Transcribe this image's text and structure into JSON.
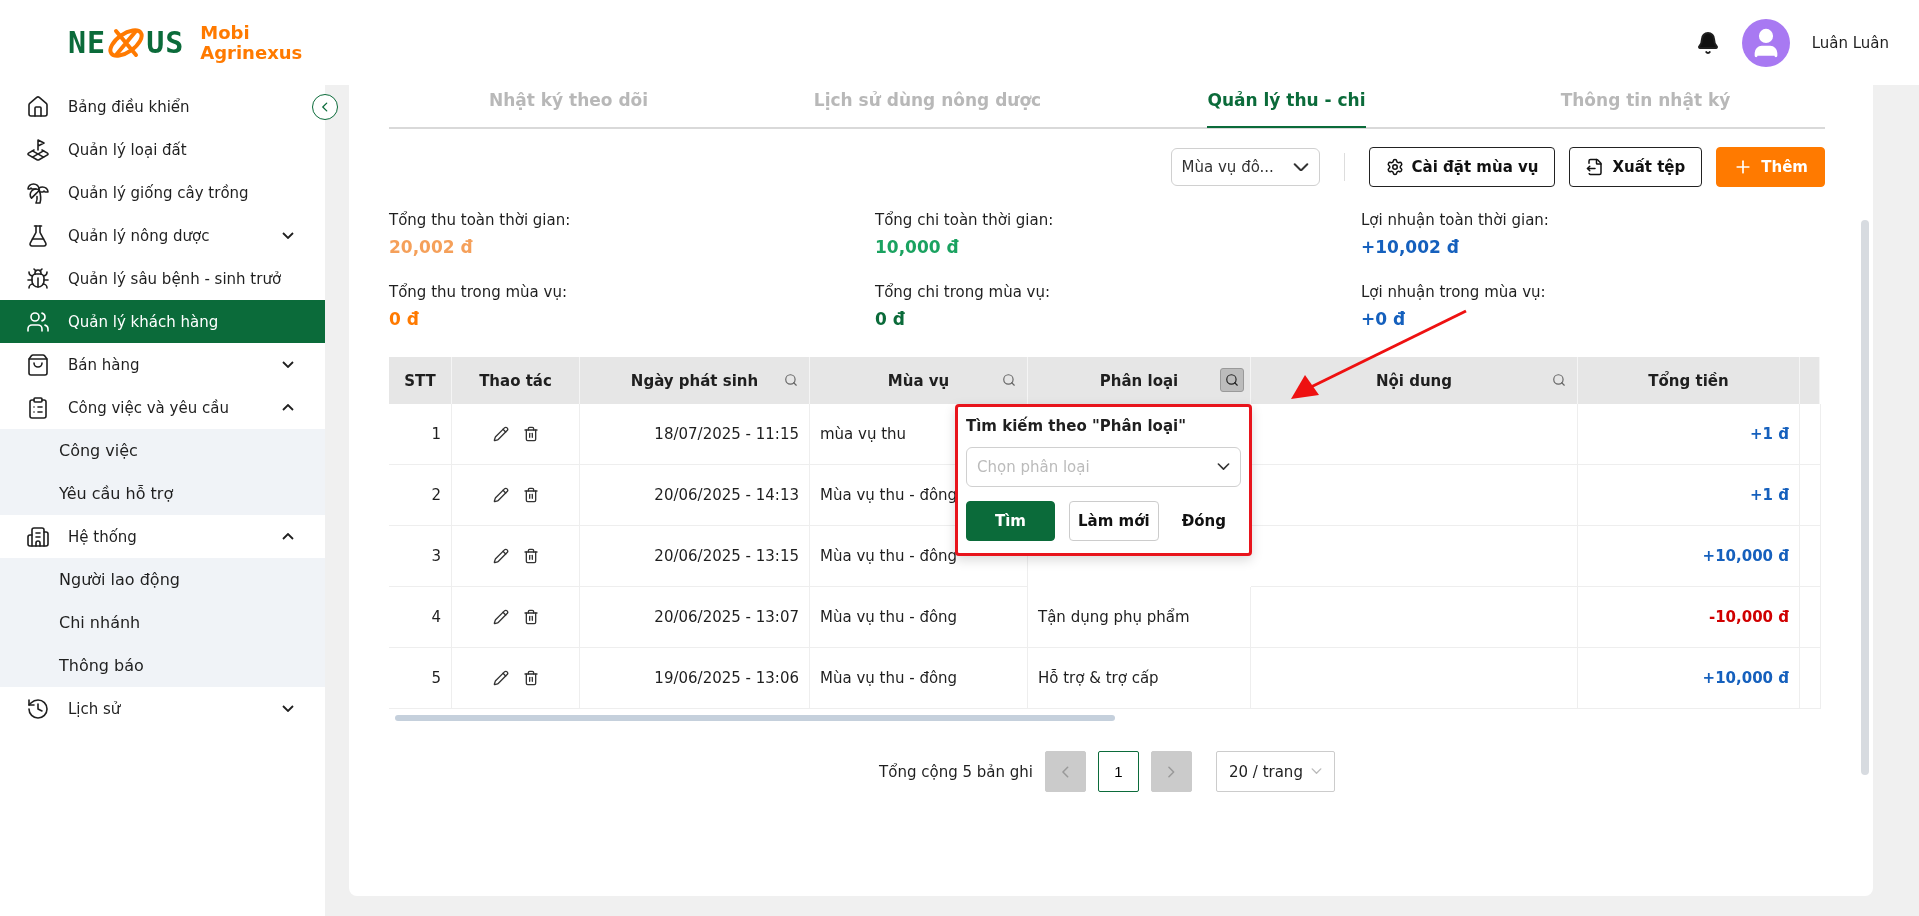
{
  "brand": {
    "logo_left": "NE",
    "logo_right": "US",
    "line1": "Mobi",
    "line2": "Agrinexus"
  },
  "user": {
    "name": "Luân Luân"
  },
  "sidebar": {
    "items": [
      {
        "label": "Bảng điều khiển",
        "selected": false
      },
      {
        "label": "Quản lý loại đất",
        "selected": false
      },
      {
        "label": "Quản lý giống cây trồng",
        "selected": false
      },
      {
        "label": "Quản lý nông dược",
        "selected": false,
        "expanded": false
      },
      {
        "label": "Quản lý sâu bệnh - sinh trưở",
        "selected": false
      },
      {
        "label": "Quản lý khách hàng",
        "selected": true
      },
      {
        "label": "Bán hàng",
        "selected": false,
        "expanded": false
      },
      {
        "label": "Công việc và yêu cầu",
        "selected": false,
        "expanded": true,
        "children": [
          {
            "label": "Công việc",
            "selected": false
          },
          {
            "label": "Yêu cầu hỗ trợ",
            "selected": false
          }
        ]
      },
      {
        "label": "Hệ thống",
        "selected": false,
        "expanded": true,
        "children": [
          {
            "label": "Người lao động",
            "selected": false
          },
          {
            "label": "Chi nhánh",
            "selected": false
          },
          {
            "label": "Thông báo",
            "selected": false
          }
        ]
      },
      {
        "label": "Lịch sử",
        "selected": false,
        "expanded": false
      }
    ]
  },
  "tabs": [
    {
      "label": "Nhật ký theo dõi",
      "selected": false
    },
    {
      "label": "Lịch sử dùng nông dược",
      "selected": false
    },
    {
      "label": "Quản lý thu - chi",
      "selected": true
    },
    {
      "label": "Thông tin nhật ký",
      "selected": false
    }
  ],
  "toolbar": {
    "season_select": {
      "value": "Mùa vụ đô..."
    },
    "buttons": [
      {
        "label": "Cài đặt mùa vụ",
        "kind": "settings"
      },
      {
        "label": "Xuất tệp",
        "kind": "export"
      },
      {
        "label": "Thêm",
        "kind": "add"
      }
    ]
  },
  "summary": [
    {
      "label": "Tổng thu toàn thời gian:",
      "value": "20,002 đ",
      "color": "#f5a05a"
    },
    {
      "label": "Tổng chi toàn thời gian:",
      "value": "10,000 đ",
      "color": "#1aa260"
    },
    {
      "label": "Lợi nhuận toàn thời gian:",
      "value": "+10,002 đ",
      "color": "#1560bd"
    },
    {
      "label": "Tổng thu trong mùa vụ:",
      "value": "0 đ",
      "color": "#ff7a00"
    },
    {
      "label": "Tổng chi trong mùa vụ:",
      "value": "0 đ",
      "color": "#0b6b3a"
    },
    {
      "label": "Lợi nhuận trong mùa vụ:",
      "value": "+0 đ",
      "color": "#1560bd"
    }
  ],
  "table": {
    "columns": [
      {
        "label": "STT",
        "searchable": false
      },
      {
        "label": "Thao tác",
        "searchable": false
      },
      {
        "label": "Ngày phát sinh",
        "searchable": true,
        "search_active": false
      },
      {
        "label": "Mùa vụ",
        "searchable": true,
        "search_active": false
      },
      {
        "label": "Phân loại",
        "searchable": true,
        "search_active": true
      },
      {
        "label": "Nội dung",
        "searchable": true,
        "search_active": false
      },
      {
        "label": "Tổng tiền",
        "searchable": false
      }
    ],
    "rows": [
      {
        "stt": "1",
        "date": "18/07/2025 - 11:15",
        "season": "mùa vụ thu",
        "amount": "+1 đ",
        "color": "#1560bd"
      },
      {
        "stt": "2",
        "date": "20/06/2025 - 14:13",
        "season": "Mùa vụ thu - đông",
        "amount": "+1 đ",
        "color": "#1560bd"
      },
      {
        "stt": "3",
        "date": "20/06/2025 - 13:15",
        "season": "Mùa vụ thu - đông",
        "amount": "+10,000 đ",
        "color": "#1560bd"
      },
      {
        "stt": "4",
        "date": "20/06/2025 - 13:07",
        "season": "Mùa vụ thu - đông",
        "category": "Tận dụng phụ phẩm",
        "amount": "-10,000 đ",
        "color": "#d00000"
      },
      {
        "stt": "5",
        "date": "19/06/2025 - 13:06",
        "season": "Mùa vụ thu - đông",
        "category": "Hỗ trợ & trợ cấp",
        "amount": "+10,000 đ",
        "color": "#1560bd"
      }
    ]
  },
  "search_popup": {
    "title": "Tìm kiếm theo \"Phân loại\"",
    "placeholder": "Chọn phân loại",
    "buttons": [
      {
        "label": "Tìm",
        "kind": "primary"
      },
      {
        "label": "Làm mới",
        "kind": "outline"
      },
      {
        "label": "Đóng",
        "kind": "text"
      }
    ]
  },
  "pagination": {
    "total": "Tổng cộng 5 bản ghi",
    "page": "1",
    "page_size": "20 / trang"
  }
}
